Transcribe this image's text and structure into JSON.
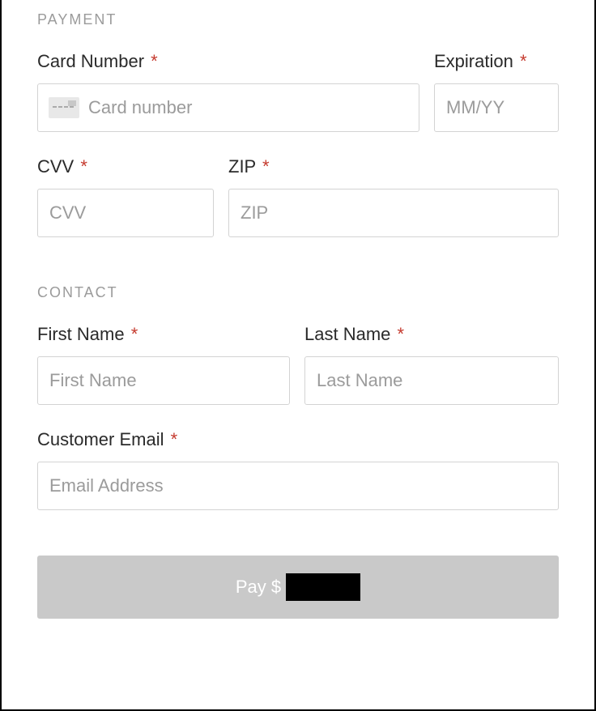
{
  "sections": {
    "payment": "PAYMENT",
    "contact": "CONTACT"
  },
  "labels": {
    "card_number": "Card Number",
    "expiration": "Expiration",
    "cvv": "CVV",
    "zip": "ZIP",
    "first_name": "First Name",
    "last_name": "Last Name",
    "customer_email": "Customer Email"
  },
  "placeholders": {
    "card_number": "Card number",
    "expiration": "MM/YY",
    "cvv": "CVV",
    "zip": "ZIP",
    "first_name": "First Name",
    "last_name": "Last Name",
    "customer_email": "Email Address"
  },
  "required_marker": "*",
  "pay_button_prefix": "Pay $"
}
